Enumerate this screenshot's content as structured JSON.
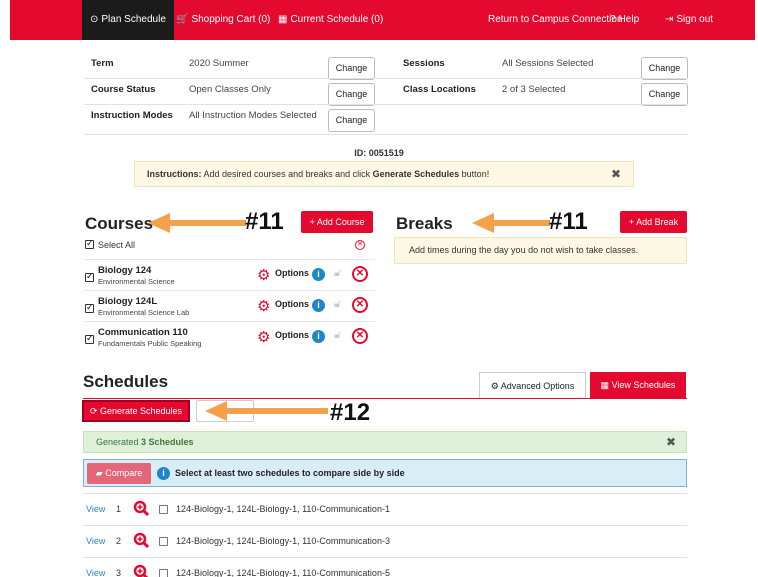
{
  "nav": {
    "plan": "Plan Schedule",
    "cart": "Shopping Cart (0)",
    "current": "Current Schedule (0)",
    "return": "Return to Campus Connection",
    "help": "Help",
    "signout": "Sign out"
  },
  "term": {
    "term_label": "Term",
    "term_value": "2020 Summer",
    "status_label": "Course Status",
    "status_value": "Open Classes Only",
    "modes_label": "Instruction Modes",
    "modes_value": "All Instruction Modes Selected",
    "sessions_label": "Sessions",
    "sessions_value": "All Sessions Selected",
    "locations_label": "Class Locations",
    "locations_value": "2 of 3 Selected",
    "change_label": "Change"
  },
  "id_line": "ID: 0051519",
  "instructions": {
    "prefix": "Instructions:",
    "text": " Add desired courses and breaks and click ",
    "strong": "Generate Schedules",
    "suffix": " button!"
  },
  "courses": {
    "title": "Courses",
    "add_label": "+ Add Course",
    "select_all": "Select All",
    "options_label": "Options",
    "items": [
      {
        "title": "Biology 124",
        "subtitle": "Environmental Science"
      },
      {
        "title": "Biology 124L",
        "subtitle": "Environmental Science Lab"
      },
      {
        "title": "Communication 110",
        "subtitle": "Fundamentals Public Speaking"
      }
    ]
  },
  "breaks": {
    "title": "Breaks",
    "add_label": "+ Add Break",
    "hint": "Add times during the day you do not wish to take classes."
  },
  "annotations": {
    "a1": "#11",
    "a2": "#11",
    "a3": "#12"
  },
  "schedules": {
    "title": "Schedules",
    "advanced_label": "Advanced Options",
    "view_label": "View Schedules",
    "generate_label": "Generate Schedules",
    "generated_prefix": "Generated ",
    "generated_count": "3 Schedules",
    "compare_label": "Compare",
    "compare_hint": "Select at least two schedules to compare side by side",
    "view_link": "View",
    "rows": [
      {
        "num": "1",
        "desc": "124-Biology-1, 124L-Biology-1, 110-Communication-1"
      },
      {
        "num": "2",
        "desc": "124-Biology-1, 124L-Biology-1, 110-Communication-3"
      },
      {
        "num": "3",
        "desc": "124-Biology-1, 124L-Biology-1, 110-Communication-5"
      }
    ]
  },
  "colors": {
    "brand": "#e4092f",
    "annotation_arrow": "#f5a04a",
    "link": "#2f7fc1"
  }
}
